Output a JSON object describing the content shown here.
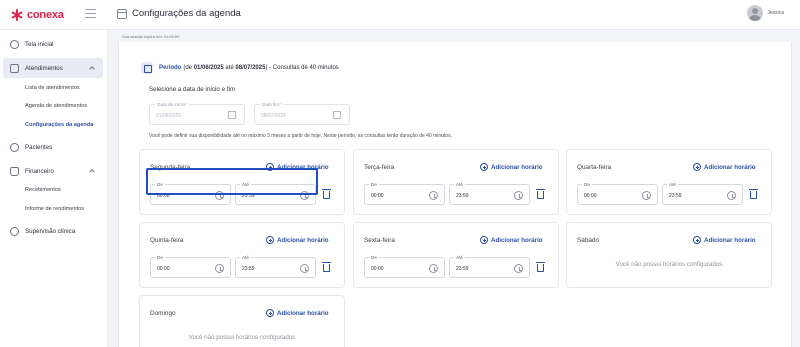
{
  "app": {
    "logo_text": "conexa"
  },
  "header": {
    "title": "Configurações da agenda"
  },
  "user": {
    "name": "Jessica"
  },
  "session": {
    "text": "Sua sessão expira em: 01:00:00"
  },
  "sidebar": {
    "items": [
      {
        "label": "Tela inicial",
        "icon": "home-icon"
      },
      {
        "label": "Atendimentos",
        "icon": "calendar-icon",
        "subitems": [
          "Lista de atendimentos",
          "Agenda de atendimentos",
          "Configurações da agenda"
        ],
        "current": "Configurações da agenda"
      },
      {
        "label": "Pacientes",
        "icon": "user-icon"
      },
      {
        "label": "Financeiro",
        "icon": "wallet-icon",
        "subitems": [
          "Recebimentos",
          "Informe de rendimentos"
        ]
      },
      {
        "label": "Supervisão clínica",
        "icon": "people-icon"
      }
    ]
  },
  "period": {
    "label": "Período",
    "prefix": "(de",
    "start": "01/06/2025",
    "mid": "até",
    "end": "08/07/2025",
    "suffix": ") - Consultas de 40 minutos"
  },
  "date_range": {
    "heading": "Selecione a data de início e fim",
    "start_label": "Data de início*",
    "start_value": "01/06/2025",
    "end_label": "Data fim*",
    "end_value": "08/07/2025"
  },
  "hint": "Você pode definir sua disponibilidade até no máximo 3 meses a partir de hoje. Neste período, as consultas terão duração de 40 minutos.",
  "add_label": "Adicionar horário",
  "from_label": "De",
  "to_label": "Até",
  "empty_text": "Você não possui horários configurados",
  "days": [
    {
      "name": "Segunda-feira",
      "from": "00:00",
      "to": "23:59"
    },
    {
      "name": "Terça-feira",
      "from": "00:00",
      "to": "23:59"
    },
    {
      "name": "Quarta-feira",
      "from": "00:00",
      "to": "23:59"
    },
    {
      "name": "Quinta-feira",
      "from": "00:00",
      "to": "23:59"
    },
    {
      "name": "Sexta-feira",
      "from": "00:00",
      "to": "23:59"
    },
    {
      "name": "Sábado"
    },
    {
      "name": "Domingo"
    }
  ],
  "colors": {
    "brand": "#e1244a",
    "accent": "#2d4fa8",
    "focus": "#1f4fc2"
  }
}
